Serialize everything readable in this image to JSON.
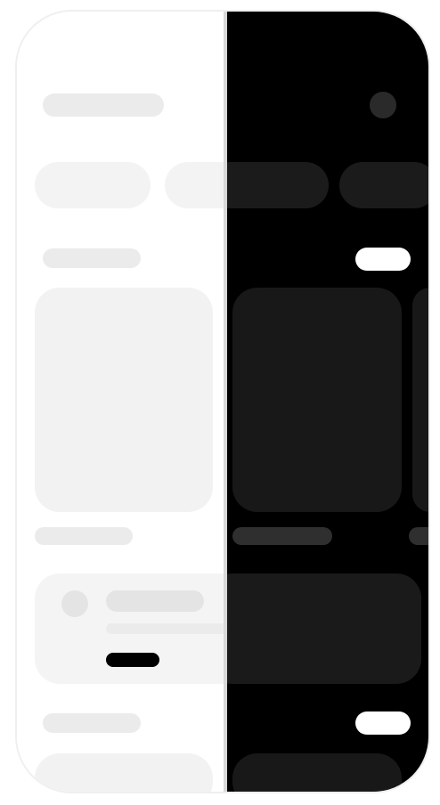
{
  "screen": {
    "type": "skeleton-placeholder",
    "variants": [
      "light",
      "dark"
    ],
    "colors": {
      "light_background": "#ffffff",
      "dark_background": "#000000",
      "light_placeholder": "#ebebeb",
      "dark_placeholder": "#1b1b1b",
      "accent_dark_pill": "#000000",
      "accent_light_pill": "#ffffff"
    }
  }
}
